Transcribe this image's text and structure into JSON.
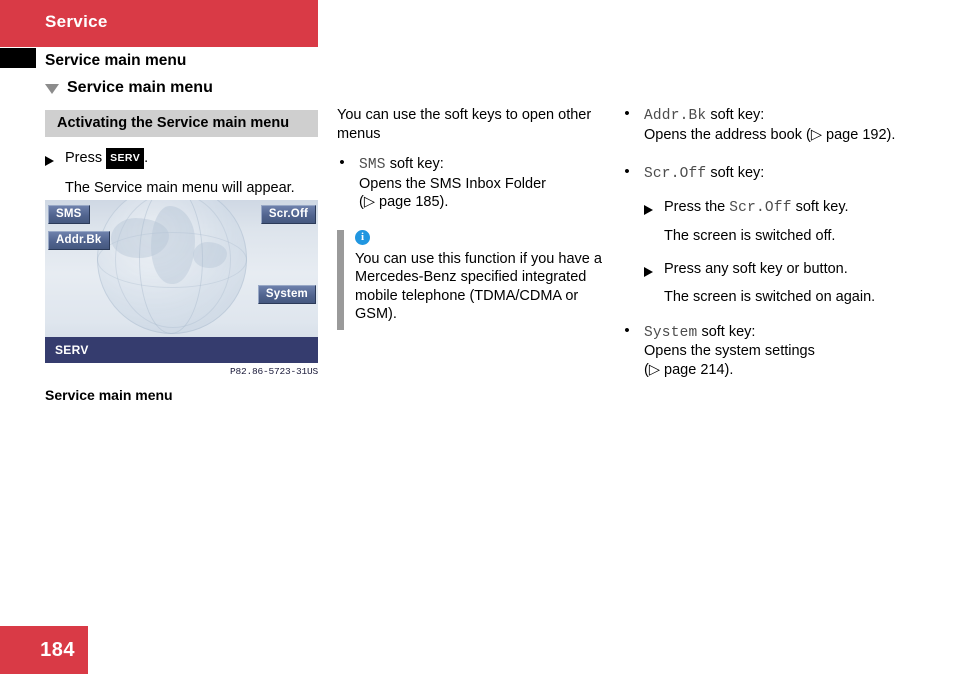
{
  "header": {
    "band_label": "Service",
    "section_title": "Service main menu",
    "subsection_title": "Service main menu"
  },
  "left_column": {
    "gray_heading": "Activating the Service main menu",
    "step_press_prefix": "Press",
    "step_press_badge": "SERV",
    "step_press_suffix": ".",
    "step_result": "The Service main menu will appear.",
    "figure": {
      "softkeys": [
        {
          "name": "sms",
          "label": "SMS"
        },
        {
          "name": "addr-bk",
          "label": "Addr.Bk"
        },
        {
          "name": "scr-off",
          "label": "Scr.Off"
        },
        {
          "name": "system",
          "label": "System"
        }
      ],
      "status_bar_label": "SERV",
      "code": "P82.86-5723-31US",
      "caption": "Service main menu"
    }
  },
  "middle_column": {
    "intro": "You can use the soft keys to open other menus",
    "bullet_sms": {
      "key": "SMS",
      "key_suffix": " soft key:",
      "line2": "Opens the SMS Inbox Folder",
      "line3_prefix": "(",
      "line3_ref": "page 185",
      "line3_suffix": ")."
    },
    "note": {
      "icon": "info-icon",
      "text": "You can use this function if you have a Mercedes-Benz specified integrated mobile telephone (TDMA/CDMA or GSM)."
    }
  },
  "right_column": {
    "bullet_addrbk": {
      "key": "Addr.Bk",
      "key_suffix": " soft key:",
      "line2_prefix": "Opens the address book (",
      "line2_ref": "page 192",
      "line2_suffix": ")."
    },
    "bullet_scroff": {
      "key": "Scr.Off",
      "key_suffix": " soft key:",
      "step1_prefix": "Press the ",
      "step1_key": "Scr.Off",
      "step1_suffix": " soft key.",
      "step1_result": "The screen is switched off.",
      "step2": "Press any soft key or button.",
      "step2_result": "The screen is switched on again."
    },
    "bullet_system": {
      "key": "System",
      "key_suffix": " soft key:",
      "line2": "Opens the system settings",
      "line3_prefix": "(",
      "line3_ref": "page 214",
      "line3_suffix": ")."
    }
  },
  "footer": {
    "page_number": "184"
  },
  "colors": {
    "brand_red": "#d93a46",
    "gray_heading_bg": "#cfcfcf",
    "softkey_blue": "#51648f",
    "status_bar_navy": "#353c6e",
    "info_icon_blue": "#2196e0"
  }
}
